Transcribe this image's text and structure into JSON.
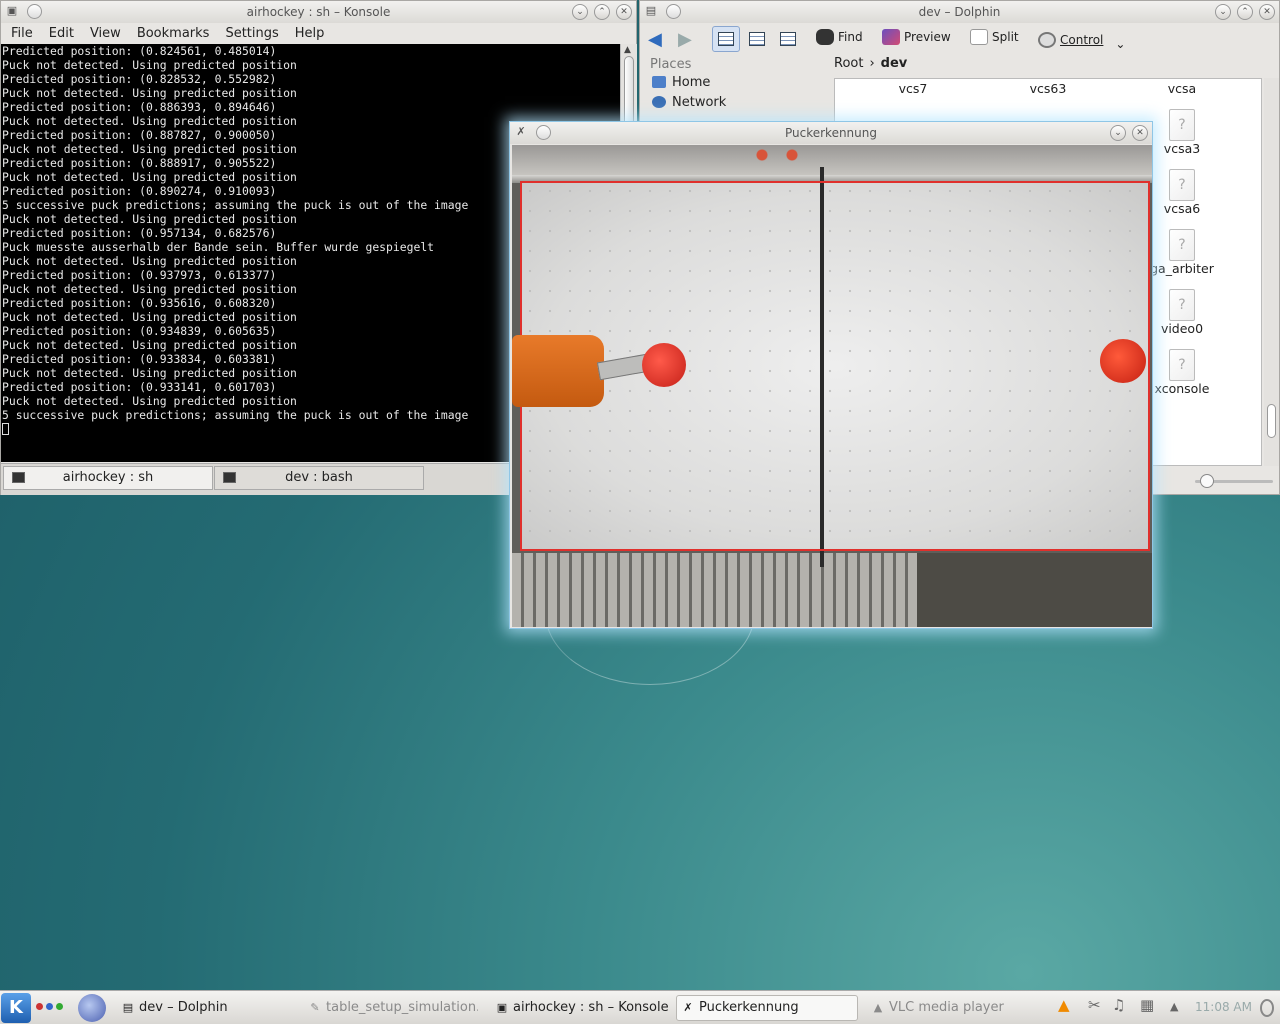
{
  "konsole": {
    "title": "airhockey : sh – Konsole",
    "menu": [
      "File",
      "Edit",
      "View",
      "Bookmarks",
      "Settings",
      "Help"
    ],
    "lines": [
      "Predicted position: (0.824561, 0.485014)",
      "Puck not detected. Using predicted position",
      "Predicted position: (0.828532, 0.552982)",
      "Puck not detected. Using predicted position",
      "Predicted position: (0.886393, 0.894646)",
      "Puck not detected. Using predicted position",
      "Predicted position: (0.887827, 0.900050)",
      "Puck not detected. Using predicted position",
      "Predicted position: (0.888917, 0.905522)",
      "Puck not detected. Using predicted position",
      "Predicted position: (0.890274, 0.910093)",
      "5 successive puck predictions; assuming the puck is out of the image",
      "Puck not detected. Using predicted position",
      "Predicted position: (0.957134, 0.682576)",
      "Puck muesste ausserhalb der Bande sein. Buffer wurde gespiegelt",
      "Puck not detected. Using predicted position",
      "Predicted position: (0.937973, 0.613377)",
      "Puck not detected. Using predicted position",
      "Predicted position: (0.935616, 0.608320)",
      "Puck not detected. Using predicted position",
      "Predicted position: (0.934839, 0.605635)",
      "Puck not detected. Using predicted position",
      "Predicted position: (0.933834, 0.603381)",
      "Puck not detected. Using predicted position",
      "Predicted position: (0.933141, 0.601703)",
      "Puck not detected. Using predicted position",
      "5 successive puck predictions; assuming the puck is out of the image"
    ],
    "tabs": [
      "airhockey : sh",
      "dev : bash"
    ]
  },
  "dolphin": {
    "title": "dev – Dolphin",
    "toolbar": {
      "find": "Find",
      "preview": "Preview",
      "split": "Split",
      "control": "Control"
    },
    "places_header": "Places",
    "places": [
      "Home",
      "Network"
    ],
    "breadcrumb": {
      "root": "Root",
      "current": "dev"
    },
    "files_top": [
      "vcs7",
      "vcs63",
      "vcsa"
    ],
    "files_right": [
      "vcsa3",
      "vcsa6",
      "ga_arbiter",
      "video0",
      "xconsole"
    ]
  },
  "pucker": {
    "title": "Puckerkennung"
  },
  "taskbar": {
    "tasks": [
      {
        "label": "dev – Dolphin",
        "state": "normal"
      },
      {
        "label": "table_setup_simulation...",
        "state": "dim"
      },
      {
        "label": "airhockey : sh – Konsole",
        "state": "normal"
      },
      {
        "label": "Puckerkennung",
        "state": "active"
      },
      {
        "label": "VLC media player",
        "state": "dim"
      }
    ],
    "clock": "11:08 AM"
  },
  "colors": {
    "kde_blue": "#2f6bbd",
    "detection_red": "#e0302c",
    "mallet_red": "#d42a1c",
    "robot_orange": "#e0701e"
  }
}
